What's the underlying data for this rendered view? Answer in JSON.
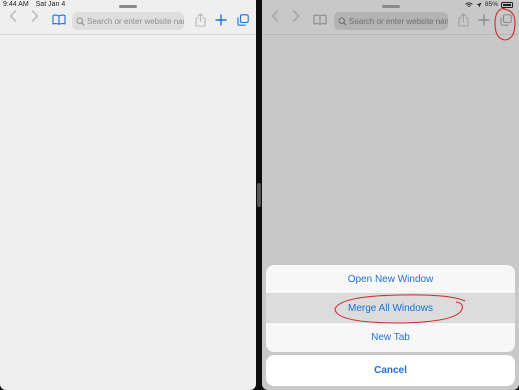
{
  "status_bar": {
    "time": "9:44 AM",
    "date": "Sat Jan 4",
    "battery": "85%"
  },
  "left_pane": {
    "search": {
      "placeholder": "Search or enter website name"
    }
  },
  "right_pane": {
    "search": {
      "placeholder": "Search or enter website name"
    },
    "action_sheet": {
      "items": [
        {
          "label": "Open New Window"
        },
        {
          "label": "Merge All Windows"
        },
        {
          "label": "New Tab"
        }
      ],
      "cancel_label": "Cancel"
    }
  },
  "icons": {
    "back": "chevron-left-icon",
    "forward": "chevron-right-icon",
    "reader": "book-icon",
    "search": "magnifier-icon",
    "share": "share-icon",
    "new_tab": "plus-icon",
    "tabs": "tabs-icon",
    "wifi": "wifi-icon",
    "location": "location-icon",
    "battery": "battery-icon"
  },
  "colors": {
    "accent": "#1f6fd6",
    "annotation": "#d12a2a",
    "dimmed_icon": "#9e9e9e"
  }
}
